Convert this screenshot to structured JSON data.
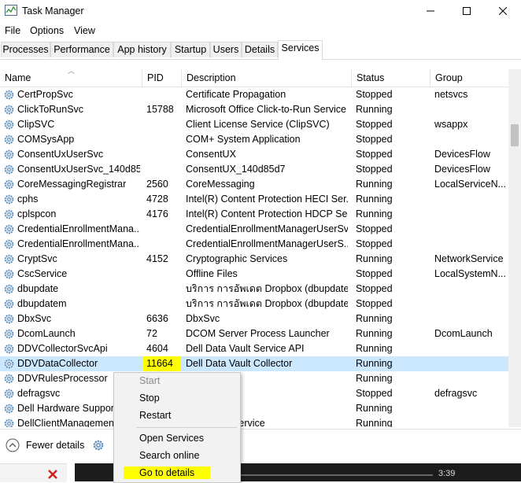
{
  "window": {
    "title": "Task Manager"
  },
  "menu": [
    "File",
    "Options",
    "View"
  ],
  "tabs": [
    "Processes",
    "Performance",
    "App history",
    "Startup",
    "Users",
    "Details",
    "Services"
  ],
  "active_tab": "Services",
  "columns": [
    "Name",
    "PID",
    "Description",
    "Status",
    "Group"
  ],
  "rows": [
    {
      "name": "CertPropSvc",
      "pid": "",
      "desc": "Certificate Propagation",
      "status": "Stopped",
      "group": "netsvcs"
    },
    {
      "name": "ClickToRunSvc",
      "pid": "15788",
      "desc": "Microsoft Office Click-to-Run Service",
      "status": "Running",
      "group": ""
    },
    {
      "name": "ClipSVC",
      "pid": "",
      "desc": "Client License Service (ClipSVC)",
      "status": "Stopped",
      "group": "wsappx"
    },
    {
      "name": "COMSysApp",
      "pid": "",
      "desc": "COM+ System Application",
      "status": "Stopped",
      "group": ""
    },
    {
      "name": "ConsentUxUserSvc",
      "pid": "",
      "desc": "ConsentUX",
      "status": "Stopped",
      "group": "DevicesFlow"
    },
    {
      "name": "ConsentUxUserSvc_140d85d7",
      "pid": "",
      "desc": "ConsentUX_140d85d7",
      "status": "Stopped",
      "group": "DevicesFlow"
    },
    {
      "name": "CoreMessagingRegistrar",
      "pid": "2560",
      "desc": "CoreMessaging",
      "status": "Running",
      "group": "LocalServiceN..."
    },
    {
      "name": "cphs",
      "pid": "4728",
      "desc": "Intel(R) Content Protection HECI Ser...",
      "status": "Running",
      "group": ""
    },
    {
      "name": "cplspcon",
      "pid": "4176",
      "desc": "Intel(R) Content Protection HDCP Se...",
      "status": "Running",
      "group": ""
    },
    {
      "name": "CredentialEnrollmentMana...",
      "pid": "",
      "desc": "CredentialEnrollmentManagerUserSvc",
      "status": "Stopped",
      "group": ""
    },
    {
      "name": "CredentialEnrollmentMana...",
      "pid": "",
      "desc": "CredentialEnrollmentManagerUserS...",
      "status": "Stopped",
      "group": ""
    },
    {
      "name": "CryptSvc",
      "pid": "4152",
      "desc": "Cryptographic Services",
      "status": "Running",
      "group": "NetworkService"
    },
    {
      "name": "CscService",
      "pid": "",
      "desc": "Offline Files",
      "status": "Stopped",
      "group": "LocalSystemN..."
    },
    {
      "name": "dbupdate",
      "pid": "",
      "desc": "บริการ การอัพเดต Dropbox (dbupdate)",
      "status": "Stopped",
      "group": ""
    },
    {
      "name": "dbupdatem",
      "pid": "",
      "desc": "บริการ การอัพเดต Dropbox (dbupdatem)",
      "status": "Stopped",
      "group": ""
    },
    {
      "name": "DbxSvc",
      "pid": "6636",
      "desc": "DbxSvc",
      "status": "Running",
      "group": ""
    },
    {
      "name": "DcomLaunch",
      "pid": "72",
      "desc": "DCOM Server Process Launcher",
      "status": "Running",
      "group": "DcomLaunch"
    },
    {
      "name": "DDVCollectorSvcApi",
      "pid": "4604",
      "desc": "Dell Data Vault Service API",
      "status": "Running",
      "group": ""
    },
    {
      "name": "DDVDataCollector",
      "pid": "11664",
      "desc": "Dell Data Vault Collector",
      "status": "Running",
      "group": ""
    },
    {
      "name": "DDVRulesProcessor",
      "pid": "",
      "desc": "t Processor",
      "status": "Running",
      "group": ""
    },
    {
      "name": "defragsvc",
      "pid": "",
      "desc": "es",
      "status": "Stopped",
      "group": "defragsvc"
    },
    {
      "name": "Dell Hardware Support",
      "pid": "",
      "desc": "e Support",
      "status": "Running",
      "group": ""
    },
    {
      "name": "DellClientManagementService",
      "pid": "",
      "desc": "nagement Service",
      "status": "Running",
      "group": ""
    }
  ],
  "context_menu": [
    "Start",
    "Stop",
    "Restart",
    "Open Services",
    "Search online",
    "Go to details"
  ],
  "footer": {
    "fewer_details": "Fewer details"
  },
  "media": {
    "time": "3:39"
  },
  "colors": {
    "selected_row": "#cce8ff",
    "highlight": "#ffff00"
  }
}
